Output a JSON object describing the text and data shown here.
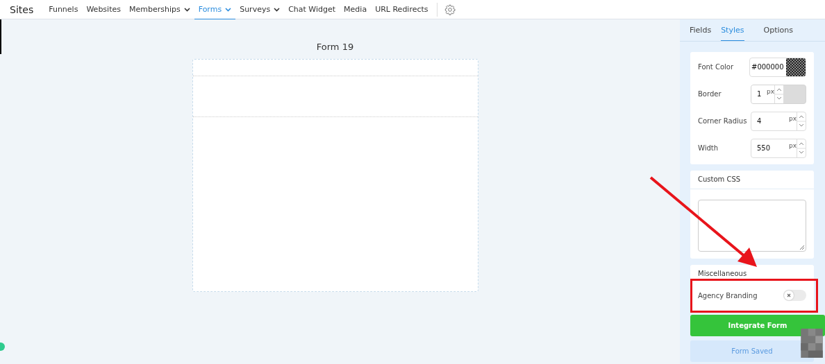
{
  "nav": {
    "title": "Sites",
    "items": [
      {
        "label": "Funnels",
        "selected": false,
        "dropdown": false
      },
      {
        "label": "Websites",
        "selected": false,
        "dropdown": false
      },
      {
        "label": "Memberships",
        "selected": false,
        "dropdown": true
      },
      {
        "label": "Forms",
        "selected": true,
        "dropdown": true
      },
      {
        "label": "Surveys",
        "selected": false,
        "dropdown": true
      },
      {
        "label": "Chat Widget",
        "selected": false,
        "dropdown": false
      },
      {
        "label": "Media",
        "selected": false,
        "dropdown": false
      },
      {
        "label": "URL Redirects",
        "selected": false,
        "dropdown": false
      }
    ]
  },
  "form": {
    "title": "Form 19"
  },
  "panel": {
    "tabs": [
      {
        "label": "Fields",
        "selected": false
      },
      {
        "label": "Styles",
        "selected": true
      },
      {
        "label": "Options",
        "selected": false
      }
    ],
    "style_fields": [
      {
        "kind": "color",
        "label": "Font Color",
        "value": "#000000"
      },
      {
        "kind": "number",
        "label": "Border",
        "value": "1",
        "unit": "px",
        "disabled": true
      },
      {
        "kind": "number",
        "label": "Corner Radius",
        "value": "4",
        "unit": "px",
        "disabled": false
      },
      {
        "kind": "number",
        "label": "Width",
        "value": "550",
        "unit": "px",
        "disabled": false
      }
    ],
    "custom_css": {
      "title": "Custom CSS"
    },
    "misc": {
      "title": "Miscellaneous",
      "toggles": [
        {
          "label": "Agency Branding",
          "on": false
        }
      ]
    },
    "buttons": [
      {
        "kind": "primary",
        "label": "Integrate Form"
      },
      {
        "kind": "secondary",
        "label": "Form Saved"
      }
    ]
  }
}
